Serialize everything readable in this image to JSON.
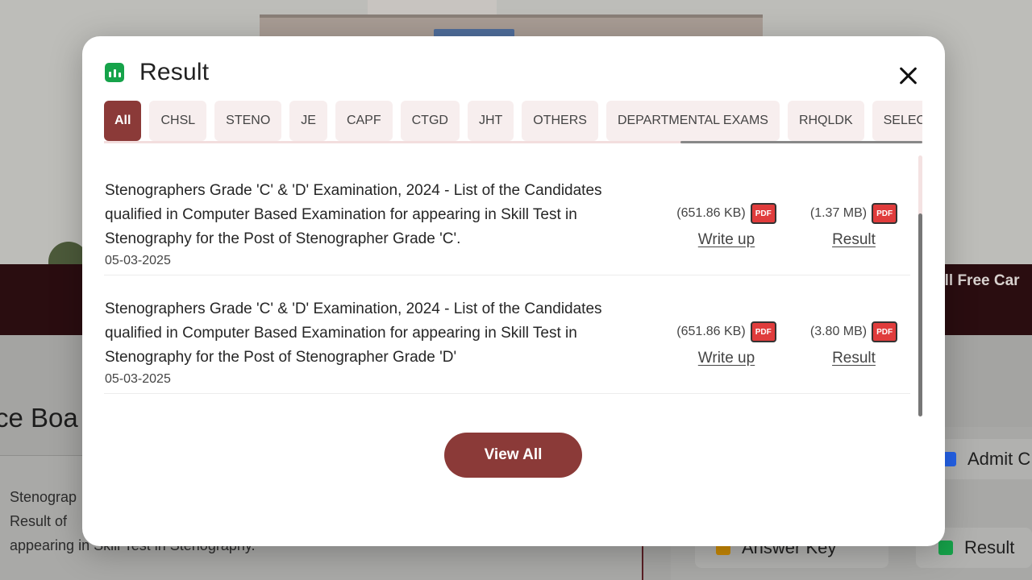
{
  "background": {
    "toll_free_text": "oll Free Car",
    "notice_board_text": "ce Boa",
    "card_text": "Stenograp\nResult of\nappearing in Skill Test in Stenography.",
    "side_tiles": [
      {
        "label": "Admit C",
        "icon": "admit-card-icon",
        "color": "#2563eb"
      },
      {
        "label": "Answer Key",
        "icon": "answer-key-icon",
        "color": "#ca8a04"
      },
      {
        "label": "Result",
        "icon": "result-icon",
        "color": "#16a34a"
      }
    ]
  },
  "modal": {
    "title": "Result",
    "icon": "bar-chart-icon",
    "accent_color": "#8b3a38",
    "close_icon": "close-icon",
    "tabs": [
      {
        "label": "All",
        "active": true
      },
      {
        "label": "CHSL",
        "active": false
      },
      {
        "label": "STENO",
        "active": false
      },
      {
        "label": "JE",
        "active": false
      },
      {
        "label": "CAPF",
        "active": false
      },
      {
        "label": "CTGD",
        "active": false
      },
      {
        "label": "JHT",
        "active": false
      },
      {
        "label": "OTHERS",
        "active": false
      },
      {
        "label": "DEPARTMENTAL EXAMS",
        "active": false
      },
      {
        "label": "RHQLDK",
        "active": false
      },
      {
        "label": "SELEC",
        "active": false
      }
    ],
    "items": [
      {
        "title": "Stenographers Grade 'C' & 'D' Examination, 2024 - List of the Candidates qualified in Computer Based Examination for appearing in Skill Test in Stenography for the Post of Stenographer Grade 'C'.",
        "date": "05-03-2025",
        "writeup": {
          "size": "(651.86 KB)",
          "badge": "PDF",
          "label": "Write up"
        },
        "result": {
          "size": "(1.37 MB)",
          "badge": "PDF",
          "label": "Result"
        }
      },
      {
        "title": "Stenographers Grade 'C' & 'D' Examination, 2024 - List of the Candidates qualified in Computer Based Examination for appearing in Skill Test in Stenography for the Post of Stenographer Grade 'D'",
        "date": "05-03-2025",
        "writeup": {
          "size": "(651.86 KB)",
          "badge": "PDF",
          "label": "Write up"
        },
        "result": {
          "size": "(3.80 MB)",
          "badge": "PDF",
          "label": "Result"
        }
      }
    ],
    "view_all_label": "View All"
  }
}
